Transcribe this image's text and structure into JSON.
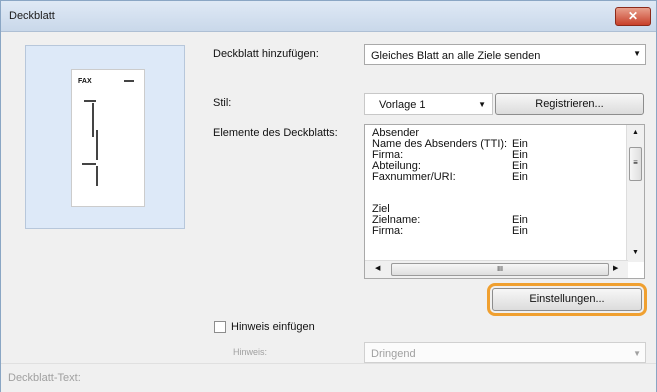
{
  "window": {
    "title": "Deckblatt",
    "close_label": "✕"
  },
  "preview": {
    "page_text": "FAX"
  },
  "form": {
    "add_cover_label": "Deckblatt hinzufügen:",
    "add_cover_value": "Gleiches Blatt an alle Ziele senden",
    "style_label": "Stil:",
    "style_value": "Vorlage 1",
    "register_button": "Registrieren...",
    "elements_label": "Elemente des Deckblatts:",
    "elements": [
      {
        "key": "Absender",
        "value": ""
      },
      {
        "key": "Name des Absenders (TTI):",
        "value": "Ein"
      },
      {
        "key": "Firma:",
        "value": "Ein"
      },
      {
        "key": "Abteilung:",
        "value": "Ein"
      },
      {
        "key": "Faxnummer/URI:",
        "value": "Ein"
      },
      {
        "key": "",
        "value": ""
      },
      {
        "key": "Ziel",
        "value": ""
      },
      {
        "key": "Zielname:",
        "value": "Ein"
      },
      {
        "key": "Firma:",
        "value": "Ein"
      }
    ],
    "settings_button": "Einstellungen...",
    "note_checkbox_label": "Hinweis einfügen",
    "note_label": "Hinweis:",
    "note_value": "Dringend",
    "cover_text_label": "Deckblatt-Text:"
  },
  "scrollbars": {
    "v_thumb": "≡",
    "h_thumb": "III"
  }
}
